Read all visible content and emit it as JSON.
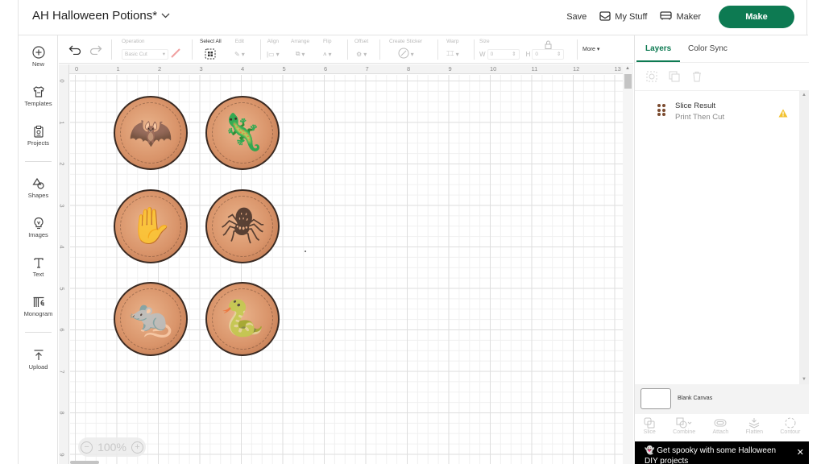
{
  "header": {
    "project_title": "AH Halloween Potions*",
    "save_label": "Save",
    "my_stuff_label": "My Stuff",
    "maker_label": "Maker",
    "make_label": "Make"
  },
  "colors": {
    "brand_green": "#0d7a52",
    "warning_yellow": "#f2c230",
    "promo_bg": "#000000"
  },
  "leftnav": {
    "items": [
      {
        "label": "New",
        "icon": "plus-circle-icon"
      },
      {
        "label": "Templates",
        "icon": "shirt-icon"
      },
      {
        "label": "Projects",
        "icon": "projects-icon"
      },
      {
        "label": "Shapes",
        "icon": "shapes-icon"
      },
      {
        "label": "Images",
        "icon": "lightbulb-icon"
      },
      {
        "label": "Text",
        "icon": "text-icon"
      },
      {
        "label": "Monogram",
        "icon": "monogram-icon"
      },
      {
        "label": "Upload",
        "icon": "upload-icon"
      }
    ]
  },
  "toolbar": {
    "operation_label": "Operation",
    "operation_value": "Basic Cut",
    "select_all_label": "Select All",
    "edit_label": "Edit",
    "align_label": "Align",
    "arrange_label": "Arrange",
    "flip_label": "Flip",
    "offset_label": "Offset",
    "create_sticker_label": "Create Sticker",
    "warp_label": "Warp",
    "size_label": "Size",
    "width_label": "W",
    "width_value": "0",
    "height_label": "H",
    "height_value": "0",
    "more_label": "More"
  },
  "canvas": {
    "ruler_x": [
      "0",
      "1",
      "2",
      "3",
      "4",
      "5",
      "6",
      "7",
      "8",
      "9",
      "10",
      "11",
      "12",
      "13"
    ],
    "ruler_y": [
      "0",
      "1",
      "2",
      "3",
      "4",
      "5",
      "6",
      "7",
      "8",
      "9"
    ],
    "zoom_level": "100%",
    "images": [
      {
        "name": "bat-coin",
        "glyph": "🦇"
      },
      {
        "name": "lizard-coin",
        "glyph": "🦎"
      },
      {
        "name": "claw-coin",
        "glyph": "✋"
      },
      {
        "name": "spider-coin",
        "glyph": "🕷"
      },
      {
        "name": "rat-coin",
        "glyph": "🐀"
      },
      {
        "name": "snake-coin",
        "glyph": "🐍"
      }
    ]
  },
  "rightpanel": {
    "tabs": [
      {
        "label": "Layers",
        "active": true
      },
      {
        "label": "Color Sync",
        "active": false
      }
    ],
    "layers": [
      {
        "name": "Slice Result",
        "subtitle": "Print Then Cut",
        "warning": true
      }
    ],
    "blank_canvas_label": "Blank Canvas",
    "bottom_tools": [
      {
        "label": "Slice",
        "icon": "slice-icon"
      },
      {
        "label": "Combine",
        "icon": "combine-icon"
      },
      {
        "label": "Attach",
        "icon": "attach-icon"
      },
      {
        "label": "Flatten",
        "icon": "flatten-icon"
      },
      {
        "label": "Contour",
        "icon": "contour-icon"
      }
    ],
    "promo_text": "Get spooky with some Halloween DIY projects"
  }
}
